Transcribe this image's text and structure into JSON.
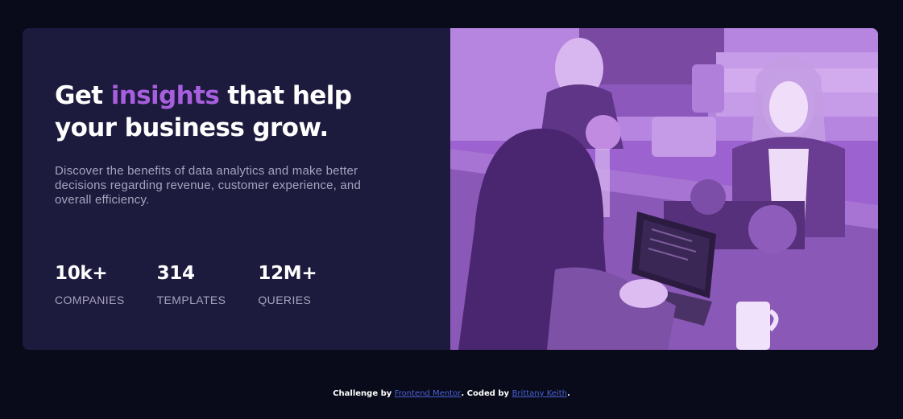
{
  "hero": {
    "headline_start": "Get ",
    "headline_accent": "insights",
    "headline_end": " that help your business grow.",
    "description": "Discover the benefits of data analytics and make better decisions regarding revenue, customer experience, and overall efficiency."
  },
  "stats": [
    {
      "value": "10k+",
      "label": "COMPANIES"
    },
    {
      "value": "314",
      "label": "TEMPLATES"
    },
    {
      "value": "12M+",
      "label": "QUERIES"
    }
  ],
  "footer": {
    "prefix": "Challenge by ",
    "link1": "Frontend Mentor",
    "middle": ". Coded by ",
    "link2": "Brittany Keith",
    "suffix": "."
  },
  "colors": {
    "page_bg": "#090b1a",
    "card_bg": "#1c1a3d",
    "accent": "#a85fde",
    "muted_text": "#a7a4bf",
    "image_tint": "#a064d4",
    "link": "#4b5fd6"
  }
}
